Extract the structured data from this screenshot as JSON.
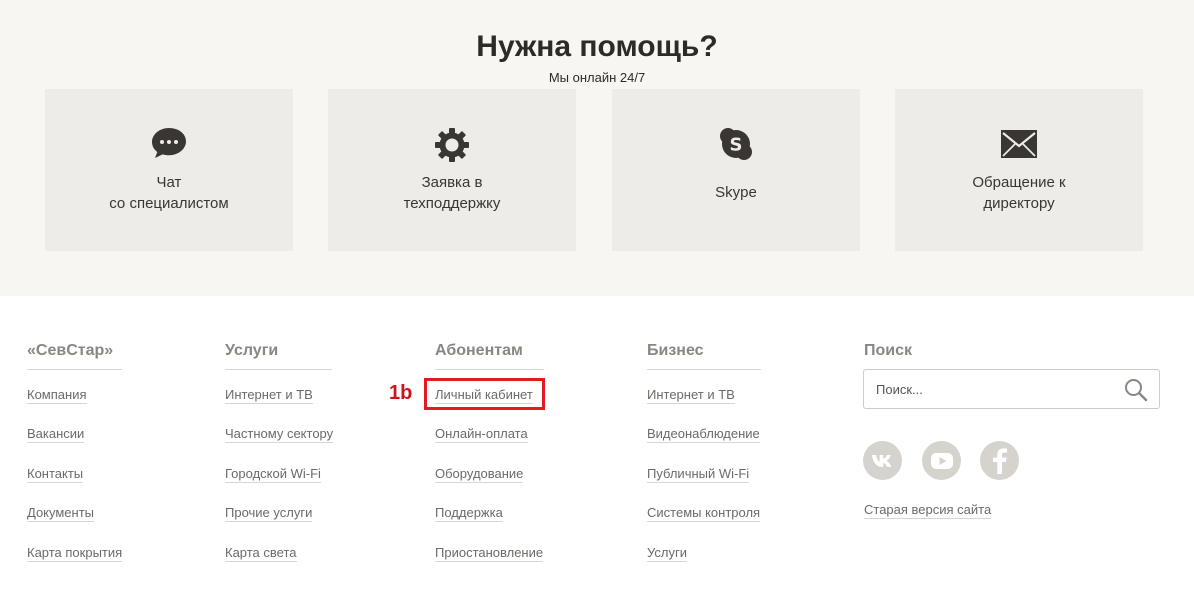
{
  "help": {
    "title": "Нужна помощь?",
    "subtitle": "Мы онлайн 24/7",
    "cards": [
      {
        "label": "Чат\nсо специалистом",
        "icon": "chat-bubble-icon"
      },
      {
        "label": "Заявка в\nтехподдержку",
        "icon": "gear-icon"
      },
      {
        "label": "Skype",
        "icon": "skype-icon"
      },
      {
        "label": "Обращение к\nдиректору",
        "icon": "envelope-icon"
      }
    ]
  },
  "footer": {
    "columns": [
      {
        "title": "«СевСтар»",
        "links": [
          "Компания",
          "Вакансии",
          "Контакты",
          "Документы",
          "Карта покрытия"
        ]
      },
      {
        "title": "Услуги",
        "links": [
          "Интернет и ТВ",
          "Частному сектору",
          "Городской Wi-Fi",
          "Прочие услуги",
          "Карта света"
        ]
      },
      {
        "title": "Абонентам",
        "links": [
          "Личный кабинет",
          "Онлайн-оплата",
          "Оборудование",
          "Поддержка",
          "Приостановление"
        ]
      },
      {
        "title": "Бизнес",
        "links": [
          "Интернет и ТВ",
          "Видеонаблюдение",
          "Публичный Wi-Fi",
          "Системы контроля",
          "Услуги"
        ]
      }
    ],
    "search": {
      "title": "Поиск",
      "placeholder": "Поиск..."
    },
    "social": [
      "vk-icon",
      "youtube-icon",
      "facebook-icon"
    ],
    "old_site_link": "Старая версия сайта"
  },
  "annotation": {
    "label": "1b",
    "color": "#e01b24"
  }
}
